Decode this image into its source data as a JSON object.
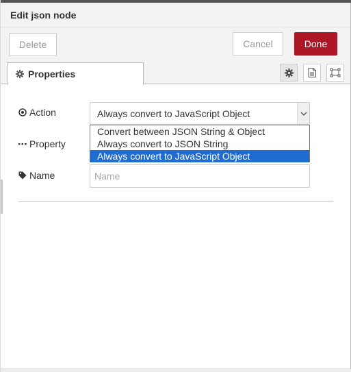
{
  "header": {
    "title": "Edit json node"
  },
  "toolbar": {
    "delete_label": "Delete",
    "cancel_label": "Cancel",
    "done_label": "Done",
    "done_color": "#ad1625"
  },
  "tabs": {
    "properties_label": "Properties",
    "icons": [
      "gear-icon",
      "description-icon",
      "appearance-icon"
    ]
  },
  "form": {
    "action": {
      "label": "Action",
      "icon": "dot-circle-icon",
      "selected_value": "Always convert to JavaScript Object",
      "options": [
        "Convert between JSON String & Object",
        "Always convert to JSON String",
        "Always convert to JavaScript Object"
      ],
      "highlighted_index": 2
    },
    "property": {
      "label": "Property",
      "icon": "ellipsis-icon"
    },
    "name": {
      "label": "Name",
      "icon": "tag-icon",
      "placeholder": "Name",
      "value": ""
    }
  },
  "colors": {
    "accent": "#ad1625",
    "highlight": "#1f6dd1",
    "header_bg": "#f3f3f3"
  }
}
